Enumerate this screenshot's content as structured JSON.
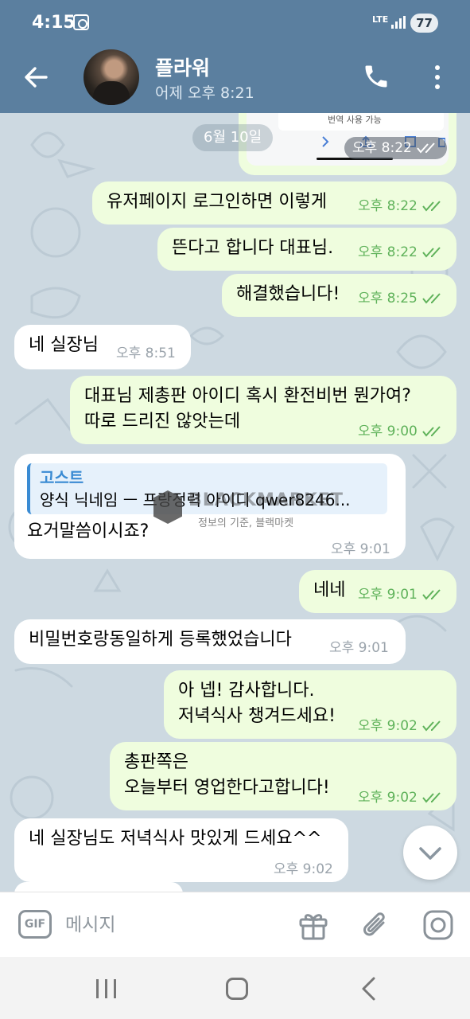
{
  "status_bar": {
    "time": "4:15",
    "network": "LTE",
    "battery": "77"
  },
  "header": {
    "contact_name": "플라워",
    "last_seen": "어제 오후 8:21"
  },
  "colors": {
    "header_bg": "#5b7f9f",
    "outgoing_bubble": "#effdde",
    "incoming_bubble": "#ffffff",
    "time_out": "#5fb25a",
    "link_blue": "#3a8bd3"
  },
  "date_chip": "6월 10일",
  "screenshot_card": {
    "banner_text": "번역 사용 가능",
    "time": "오후 8:22"
  },
  "messages": [
    {
      "dir": "out",
      "text": "유저페이지 로그인하면 이렇게",
      "time": "오후 8:22"
    },
    {
      "dir": "out",
      "text": "뜬다고 합니다 대표님.",
      "time": "오후 8:22"
    },
    {
      "dir": "out",
      "text": "해결했습니다!",
      "time": "오후 8:25"
    },
    {
      "dir": "in",
      "text": "네 실장님",
      "time": "오후 8:51"
    },
    {
      "dir": "out",
      "lines": [
        "대표님 제총판 아이디 혹시 환전비번 뭔가여?",
        "따로 드리진 않앗는데"
      ],
      "time": "오후 9:00"
    },
    {
      "dir": "in",
      "reply_name": "고스트",
      "reply_text": "양식 닉네임 ㅡ 프랑정력 아이디 qwer8246...",
      "text": "요거말씀이시죠?",
      "time": "오후 9:01"
    },
    {
      "dir": "out",
      "text": "네네",
      "time": "오후 9:01"
    },
    {
      "dir": "in",
      "text": "비밀번호랑동일하게 등록했었습니다",
      "time": "오후 9:01"
    },
    {
      "dir": "out",
      "lines": [
        "아 넵! 감사합니다.",
        "저녁식사 챙겨드세요!"
      ],
      "time": "오후 9:02"
    },
    {
      "dir": "out",
      "lines": [
        "총판쪽은",
        "오늘부터 영업한다고합니다!"
      ],
      "time": "오후 9:02"
    },
    {
      "dir": "in",
      "text": "네 실장님도 저녁식사 맛있게 드세요^^",
      "time": "오후 9:02"
    }
  ],
  "watermark": {
    "title": "BLACKMARKET",
    "subtitle": "정보의 기준, 블랙마켓"
  },
  "input": {
    "gif_label": "GIF",
    "placeholder": "메시지"
  }
}
